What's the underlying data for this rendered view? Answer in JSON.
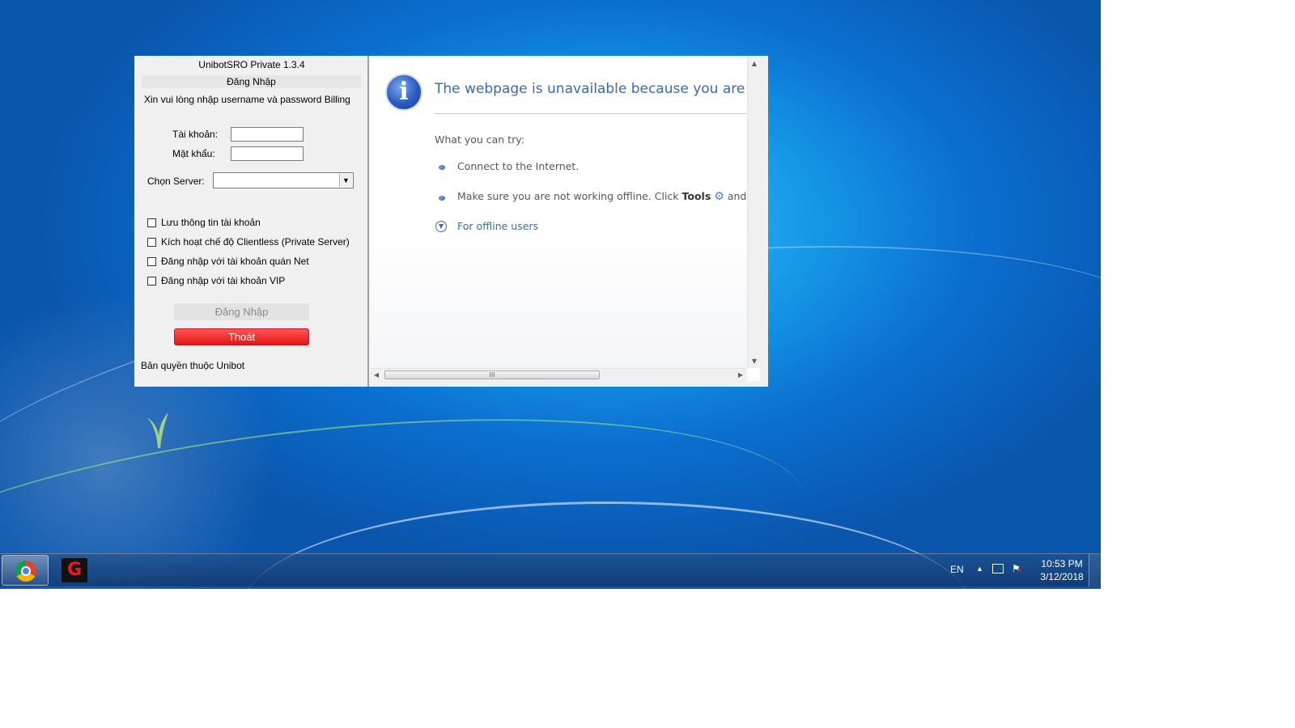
{
  "app": {
    "title": "UnibotSRO Private 1.3.4",
    "section_header": "Đăng Nhập",
    "instructions": "Xin vui lòng nhập username và password Billing",
    "username_label": "Tài khoản:",
    "password_label": "Mật khẩu:",
    "server_label": "Chọn Server:",
    "checkboxes": [
      {
        "label": "Lưu thông tin tài khoản",
        "checked": false
      },
      {
        "label": "Kích hoạt chế độ Clientless (Private Server)",
        "checked": false
      },
      {
        "label": "Đăng nhập với tài khoản quán Net",
        "checked": false
      },
      {
        "label": "Đăng nhập với tài khoản VIP",
        "checked": false
      }
    ],
    "login_button": "Đăng Nhập",
    "exit_button": "Thoát",
    "copyright": "Bản quyền thuộc Unibot"
  },
  "browser": {
    "headline": "The webpage is unavailable because you are offline",
    "subtitle": "What you can try:",
    "items": [
      "Connect to the Internet.",
      "Make sure you are not working offline. Click "
    ],
    "tools_label": "Tools",
    "item2_suffix": " and",
    "offline_link": "For offline users",
    "scroll_grip": "III"
  },
  "taskbar": {
    "language": "EN",
    "time": "10:53 PM",
    "date": "3/12/2018"
  },
  "icons": {
    "start": "chrome-icon",
    "app": "garena-icon",
    "info": "info-icon",
    "gear": "gear-icon"
  }
}
